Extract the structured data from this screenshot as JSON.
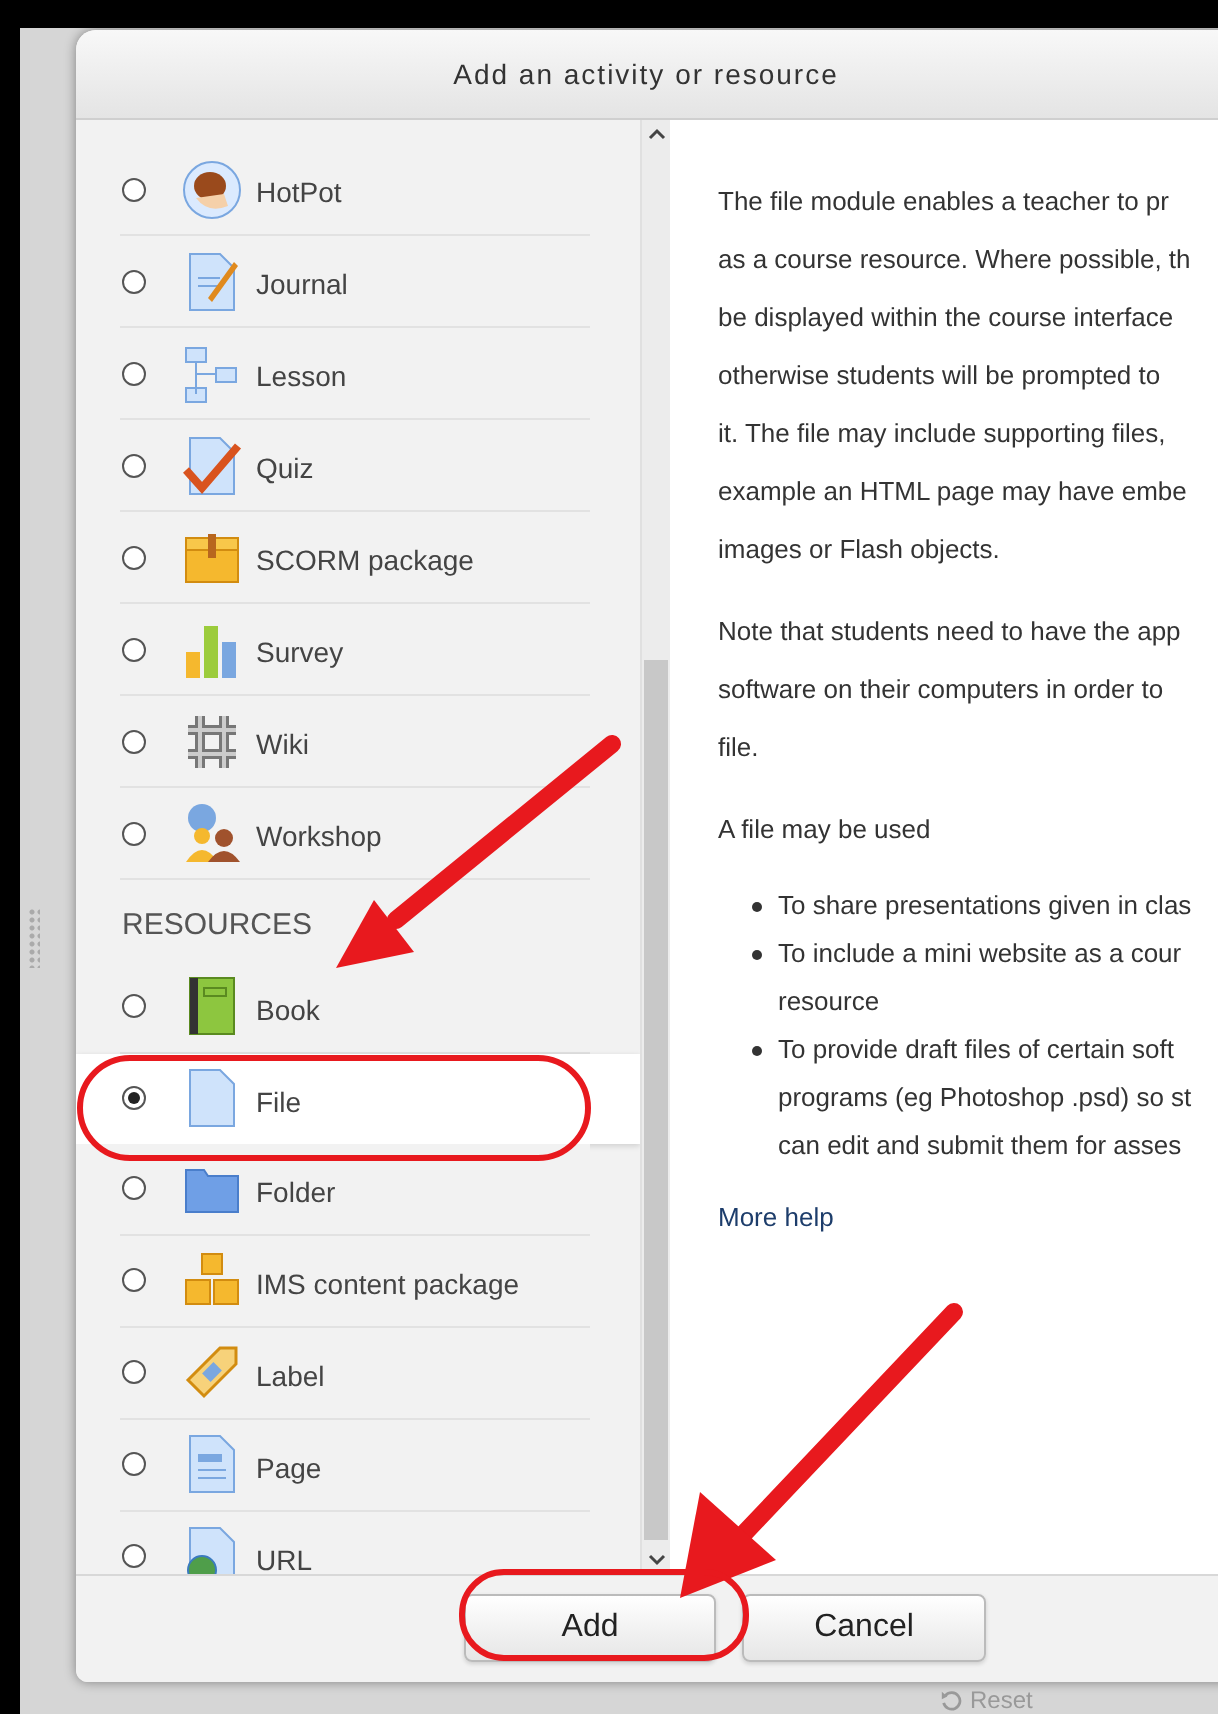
{
  "dialog": {
    "title": "Add an activity or resource"
  },
  "activities": [
    {
      "label": "HotPot",
      "selected": false
    },
    {
      "label": "Journal",
      "selected": false
    },
    {
      "label": "Lesson",
      "selected": false
    },
    {
      "label": "Quiz",
      "selected": false
    },
    {
      "label": "SCORM package",
      "selected": false
    },
    {
      "label": "Survey",
      "selected": false
    },
    {
      "label": "Wiki",
      "selected": false
    },
    {
      "label": "Workshop",
      "selected": false
    }
  ],
  "resources": {
    "heading": "RESOURCES",
    "items": [
      {
        "label": "Book",
        "selected": false
      },
      {
        "label": "File",
        "selected": true
      },
      {
        "label": "Folder",
        "selected": false
      },
      {
        "label": "IMS content package",
        "selected": false
      },
      {
        "label": "Label",
        "selected": false
      },
      {
        "label": "Page",
        "selected": false
      },
      {
        "label": "URL",
        "selected": false
      }
    ]
  },
  "description": {
    "paragraphs": [
      [
        "The file module enables a teacher to pr",
        "as a course resource. Where possible, th",
        "be displayed within the course interface",
        "otherwise students will be prompted to",
        "it. The file may include supporting files,",
        "example an HTML page may have embe",
        "images or Flash objects."
      ],
      [
        "Note that students need to have the app",
        "software on their computers in order to",
        "file."
      ],
      [
        "A file may be used"
      ]
    ],
    "bullets": [
      [
        "To share presentations given in clas"
      ],
      [
        "To include a mini website as a cour",
        "resource"
      ],
      [
        "To provide draft files of certain soft",
        "programs (eg Photoshop .psd) so st",
        "can edit and submit them for asses"
      ]
    ],
    "link": "More help"
  },
  "buttons": [
    "Add",
    "Cancel"
  ],
  "behind": {
    "reset": "Reset"
  }
}
